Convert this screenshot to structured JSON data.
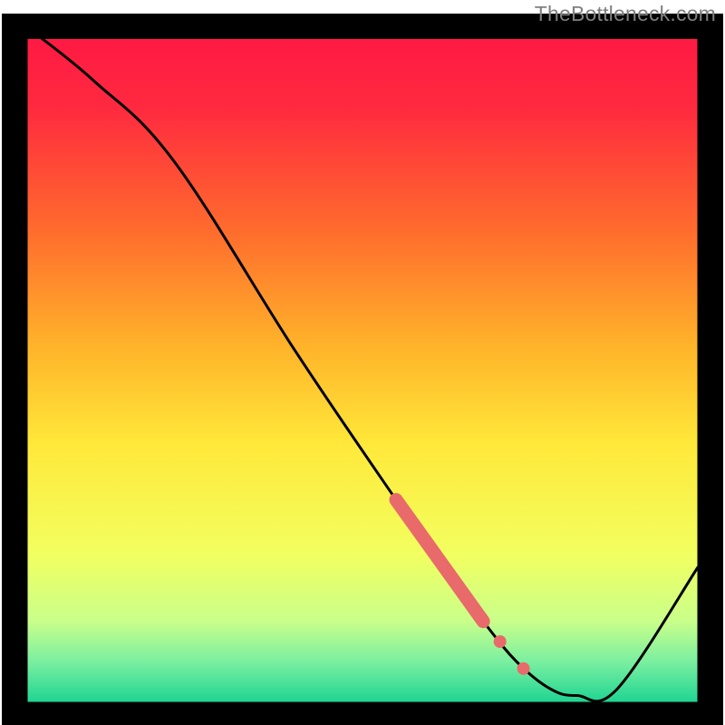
{
  "attribution": "TheBottleneck.com",
  "chart_data": {
    "type": "line",
    "title": "",
    "xlabel": "",
    "ylabel": "",
    "xlim": [
      0,
      100
    ],
    "ylim": [
      0,
      100
    ],
    "series": [
      {
        "name": "curve",
        "x": [
          0,
          10,
          22,
          40,
          55,
          62,
          68,
          73,
          78,
          82,
          88,
          100
        ],
        "y": [
          100,
          92,
          80,
          52,
          30,
          20,
          12,
          6,
          2,
          1,
          2,
          20
        ]
      }
    ],
    "highlights": [
      {
        "name": "thick-segment",
        "x": [
          55,
          68
        ],
        "y": [
          30,
          12
        ],
        "style": "thick"
      },
      {
        "name": "dot-1",
        "x": 70.5,
        "y": 9
      },
      {
        "name": "dot-2",
        "x": 74,
        "y": 5
      }
    ],
    "background": {
      "type": "vertical-gradient",
      "stops": [
        {
          "pos": 0.0,
          "color": "#ff1744"
        },
        {
          "pos": 0.12,
          "color": "#ff2a3f"
        },
        {
          "pos": 0.3,
          "color": "#ff6b2d"
        },
        {
          "pos": 0.48,
          "color": "#ffb62a"
        },
        {
          "pos": 0.62,
          "color": "#ffe93a"
        },
        {
          "pos": 0.78,
          "color": "#f2ff60"
        },
        {
          "pos": 0.88,
          "color": "#c9ff8a"
        },
        {
          "pos": 0.94,
          "color": "#7aefa0"
        },
        {
          "pos": 1.0,
          "color": "#1fd492"
        }
      ]
    },
    "frame_color": "#000000",
    "curve_color": "#000000",
    "highlight_color": "#e96a6a"
  }
}
